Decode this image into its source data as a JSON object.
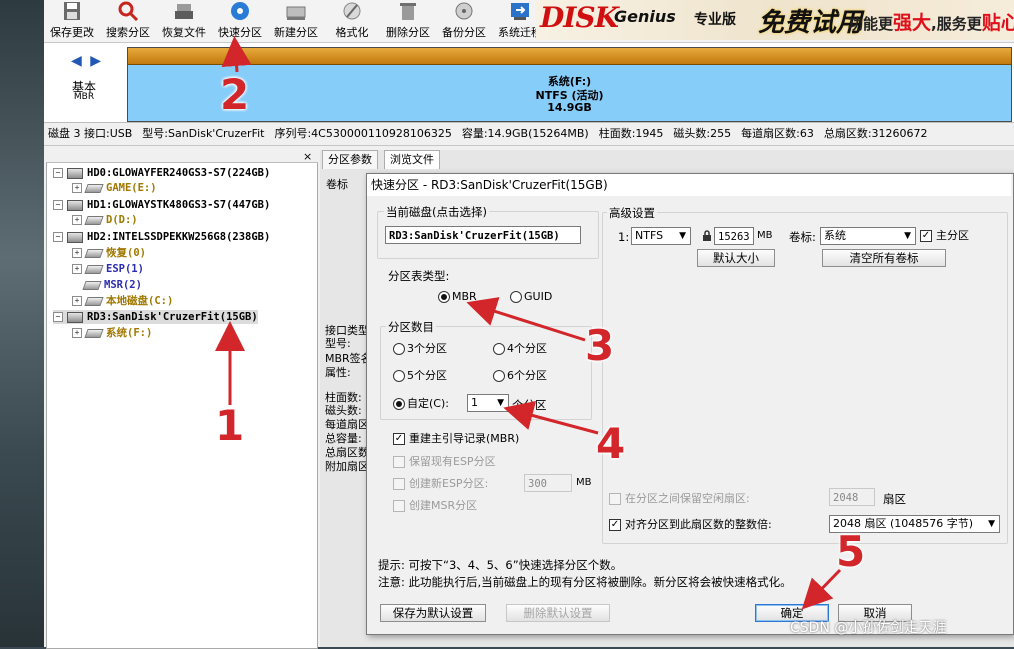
{
  "toolbar": {
    "items": [
      {
        "label": "保存更改",
        "icon": "save-icon"
      },
      {
        "label": "搜索分区",
        "icon": "search-icon"
      },
      {
        "label": "恢复文件",
        "icon": "recover-icon"
      },
      {
        "label": "快速分区",
        "icon": "quick-partition-icon"
      },
      {
        "label": "新建分区",
        "icon": "new-partition-icon"
      },
      {
        "label": "格式化",
        "icon": "format-icon"
      },
      {
        "label": "删除分区",
        "icon": "delete-icon"
      },
      {
        "label": "备份分区",
        "icon": "backup-icon"
      },
      {
        "label": "系统迁移",
        "icon": "migrate-icon"
      }
    ]
  },
  "banner": {
    "logo_main": "DISK",
    "logo_word": "Genius",
    "edition": "专业版",
    "promo": "免费试用",
    "slogan_a": "功能更",
    "slogan_b": "强大",
    "slogan_c": ",服务更",
    "slogan_d": "贴心"
  },
  "diskmap": {
    "nav": "◀ ▶",
    "disk_kind": "基本",
    "disk_style": "MBR",
    "partition_name": "系统(F:)",
    "partition_fs": "NTFS (活动)",
    "partition_size": "14.9GB"
  },
  "infoline": {
    "disk": "磁盘 3 接口:USB",
    "model": "型号:SanDisk'CruzerFit",
    "serial": "序列号:4C530000110928106325",
    "capacity": "容量:14.9GB(15264MB)",
    "cylinders": "柱面数:1945",
    "heads": "磁头数:255",
    "sectors_per_track": "每道扇区数:63",
    "total_sectors": "总扇区数:31260672"
  },
  "tree": {
    "close": "×",
    "nodes": [
      {
        "text": "HD0:GLOWAYFER240GS3-S7(224GB)",
        "kind": "disk"
      },
      {
        "text": "GAME(E:)",
        "kind": "part",
        "color": "olive"
      },
      {
        "text": "HD1:GLOWAYSTK480GS3-S7(447GB)",
        "kind": "disk"
      },
      {
        "text": "D(D:)",
        "kind": "part",
        "color": "olive"
      },
      {
        "text": "HD2:INTELSSDPEKKW256G8(238GB)",
        "kind": "disk"
      },
      {
        "text": "恢复(0)",
        "kind": "part",
        "color": "olive"
      },
      {
        "text": "ESP(1)",
        "kind": "part",
        "color": "navy"
      },
      {
        "text": "MSR(2)",
        "kind": "part",
        "color": "navy"
      },
      {
        "text": "本地磁盘(C:)",
        "kind": "part",
        "color": "olive"
      },
      {
        "text": "RD3:SanDisk'CruzerFit(15GB)",
        "kind": "disk"
      },
      {
        "text": "系统(F:)",
        "kind": "part",
        "color": "olive"
      }
    ]
  },
  "rightpane": {
    "tab1": "分区参数",
    "tab2": "浏览文件",
    "volume_label": "卷标",
    "side": [
      "接口类型:",
      "型号:",
      "MBR签名:",
      "属性:",
      "柱面数:",
      "磁头数:",
      "每道扇区",
      "总容量:",
      "总扇区数",
      "附加扇区"
    ]
  },
  "dialog": {
    "title": "快速分区 - RD3:SanDisk'CruzerFit(15GB)",
    "current_disk_title": "当前磁盘(点击选择)",
    "current_disk": "RD3:SanDisk'CruzerFit(15GB)",
    "ptype_title": "分区表类型:",
    "ptype_mbr": "MBR",
    "ptype_guid": "GUID",
    "count_title": "分区数目",
    "count3": "3个分区",
    "count4": "4个分区",
    "count5": "5个分区",
    "count6": "6个分区",
    "custom": "自定(C):",
    "custom_value": "1",
    "custom_suffix": "个分区",
    "rebuild_mbr": "重建主引导记录(MBR)",
    "keep_esp": "保留现有ESP分区",
    "create_esp": "创建新ESP分区:",
    "esp_size": "300",
    "esp_unit": "MB",
    "create_msr": "创建MSR分区",
    "advanced_title": "高级设置",
    "row_index": "1:",
    "fs": "NTFS",
    "size": "15263",
    "size_unit": "MB",
    "label_caption": "卷标:",
    "label_value": "系统",
    "primary": "主分区",
    "default_size": "默认大小",
    "clear_labels": "清空所有卷标",
    "reserve_gap": "在分区之间保留空闲扇区:",
    "reserve_value": "2048",
    "reserve_unit": "扇区",
    "align": "对齐分区到此扇区数的整数倍:",
    "align_value": "2048 扇区 (1048576 字节)",
    "hint": "提示: 可按下“3、4、5、6”快速选择分区个数。",
    "note": "注意: 此功能执行后,当前磁盘上的现有分区将被删除。新分区将会被快速格式化。",
    "save_default": "保存为默认设置",
    "delete_default": "删除默认设置",
    "ok": "确定",
    "cancel": "取消"
  },
  "annotations": [
    "1",
    "2",
    "3",
    "4",
    "5"
  ],
  "watermark": "CSDN @小孙佐剑走天涯",
  "colors": {
    "accent": "#d2262a",
    "partition_bar": "#87cdfa",
    "partition_top": "#c27a0d"
  }
}
